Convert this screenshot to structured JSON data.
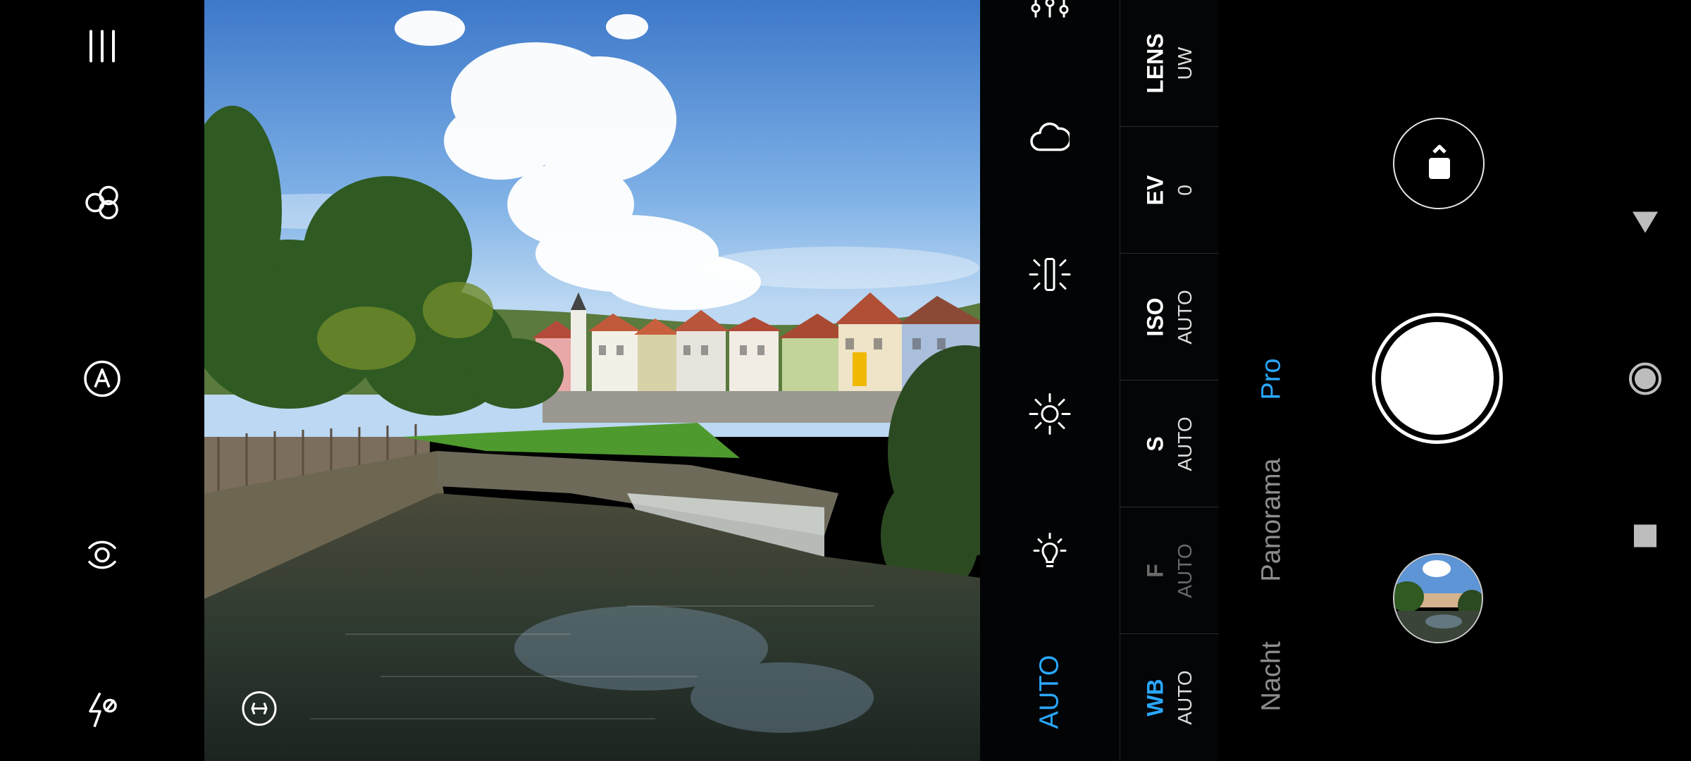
{
  "left_toolbar": {
    "icons": [
      "menu-icon",
      "filter-icon",
      "auto-focus-icon",
      "timer-icon",
      "flash-off-icon"
    ]
  },
  "viewfinder": {
    "meter_icon": "metering-icon"
  },
  "pro_panel": {
    "icons": [
      "sliders-icon",
      "cloud-icon",
      "fluorescent-icon",
      "sun-icon",
      "bulb-icon"
    ],
    "auto_mode_label": "AUTO",
    "params": [
      {
        "name": "LENS",
        "value": "UW",
        "state": "normal"
      },
      {
        "name": "EV",
        "value": "0",
        "state": "normal"
      },
      {
        "name": "ISO",
        "value": "AUTO",
        "state": "normal"
      },
      {
        "name": "S",
        "value": "AUTO",
        "state": "normal"
      },
      {
        "name": "F",
        "value": "AUTO",
        "state": "disabled"
      },
      {
        "name": "WB",
        "value": "AUTO",
        "state": "active"
      }
    ]
  },
  "modes": {
    "items": [
      "Pro",
      "Panorama",
      "Nacht"
    ],
    "active": "Pro"
  },
  "controls": {
    "switch_camera_icon": "switch-camera-icon",
    "shutter_icon": "shutter-icon",
    "gallery_icon": "gallery-thumbnail"
  },
  "nav_bar": {
    "icons": [
      "back-icon",
      "home-icon",
      "recents-icon"
    ]
  },
  "colors": {
    "accent": "#2aa7ff",
    "background": "#000000",
    "inactive_mode": "#8d8d8d"
  }
}
